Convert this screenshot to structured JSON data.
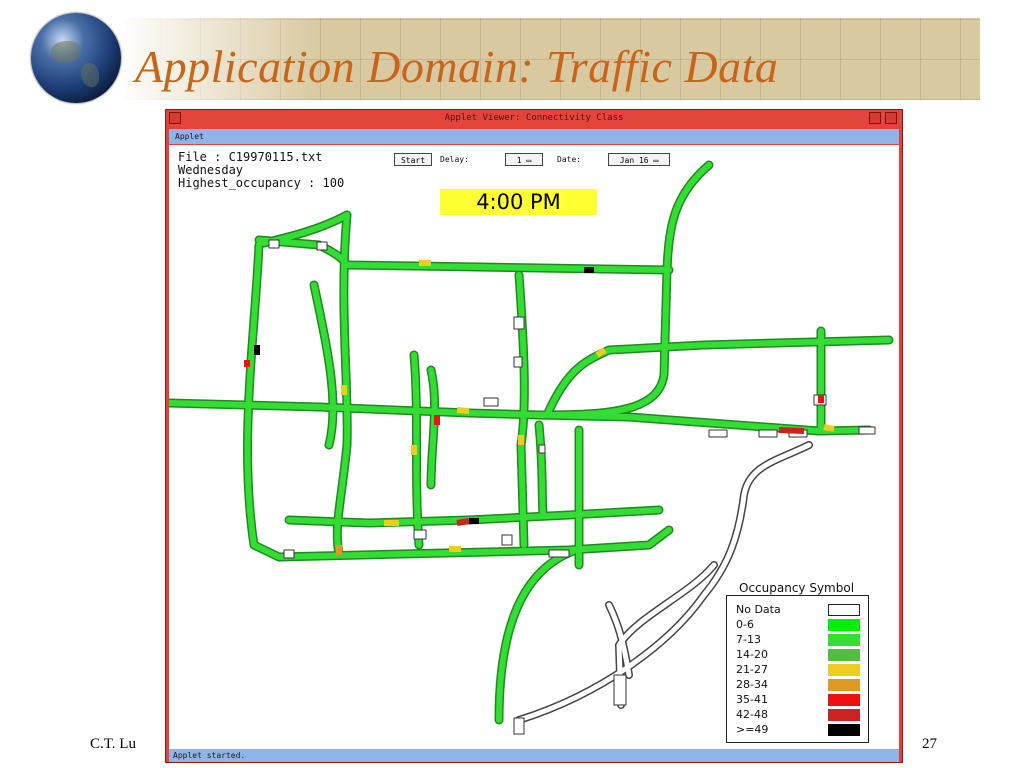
{
  "slide": {
    "title": "Application Domain: Traffic Data",
    "author": "C.T. Lu",
    "page_number": "27",
    "title_color": "#c8651b"
  },
  "window": {
    "title": "Applet Viewer: Connectivity Class",
    "menu": "Applet",
    "status": "Applet started."
  },
  "info": {
    "file": "File : C19970115.txt",
    "day": "Wednesday",
    "highest": "Highest_occupancy : 100"
  },
  "controls": {
    "start_label": "Start",
    "delay_label": "Delay:",
    "delay_value": "1",
    "date_label": "Date:",
    "date_value": "Jan 16"
  },
  "clock": "4:00 PM",
  "legend": {
    "title": "Occupancy Symbol",
    "items": [
      {
        "label": "No Data",
        "color": "#ffffff"
      },
      {
        "label": "0-6",
        "color": "#00ee00"
      },
      {
        "label": "7-13",
        "color": "#33dd33"
      },
      {
        "label": "14-20",
        "color": "#55bb44"
      },
      {
        "label": "21-27",
        "color": "#eecc22"
      },
      {
        "label": "28-34",
        "color": "#dd9922"
      },
      {
        "label": "35-41",
        "color": "#ee1111"
      },
      {
        "label": "42-48",
        "color": "#cc2222"
      },
      {
        "label": ">=49",
        "color": "#000000"
      }
    ]
  },
  "colors": {
    "road_primary": "#33dd33",
    "road_secondary": "#55bb44",
    "window_frame": "#e6403a",
    "bar": "#8fb4e6"
  }
}
